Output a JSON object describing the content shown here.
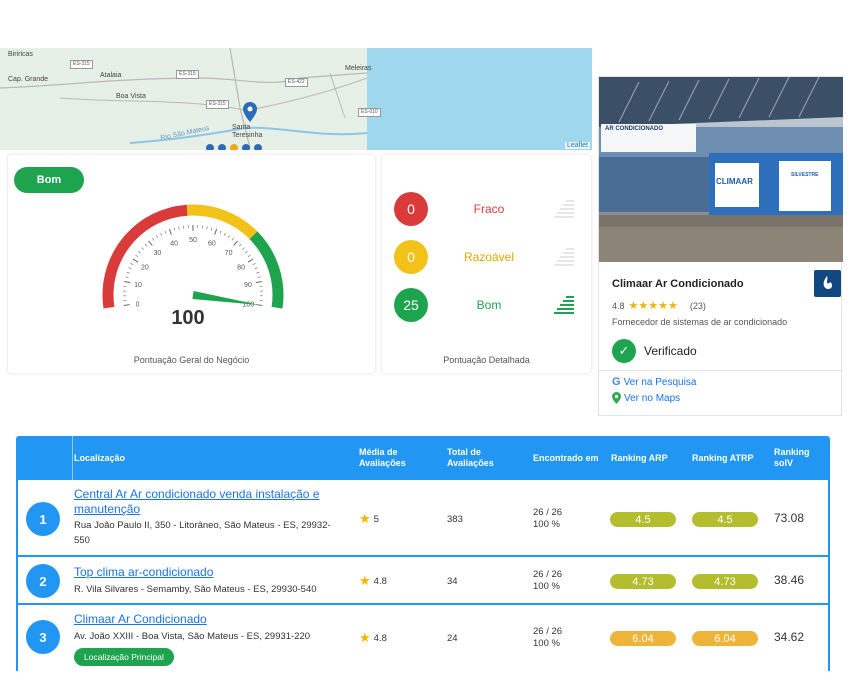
{
  "map": {
    "places": [
      "Biriricas",
      "Cap. Grande",
      "Atalaia",
      "Boa Vista",
      "Meleiras",
      "Santa Teresinha",
      "Rio São Mateus"
    ],
    "roads": [
      "ES-315",
      "ES-315",
      "ES-422",
      "ES-315",
      "ES-010"
    ],
    "attribution": "Leaflet"
  },
  "score": {
    "badge": "Bom",
    "value": "100",
    "ticks": [
      "0",
      "10",
      "20",
      "30",
      "40",
      "50",
      "60",
      "70",
      "80",
      "90",
      "100"
    ],
    "caption": "Pontuação Geral do Negócio",
    "colors": {
      "red": "#d93b3b",
      "yellow": "#f2c21b",
      "green": "#1ea44f"
    }
  },
  "detail": {
    "caption": "Pontuação Detalhada",
    "rows": [
      {
        "count": "0",
        "label": "Fraco",
        "color": "#d93b3b"
      },
      {
        "count": "0",
        "label": "Razoável",
        "color": "#f2c21b"
      },
      {
        "count": "25",
        "label": "Bom",
        "color": "#1ea44f"
      }
    ]
  },
  "business": {
    "name": "Climaar Ar Condicionado",
    "rating": "4.8",
    "reviews": "(23)",
    "category": "Fornecedor de sistemas de ar condicionado",
    "verified": "Verificado",
    "link_search": "Ver na Pesquisa",
    "link_maps": "Ver no Maps",
    "photo_signs": {
      "sign1": "AR CONDICIONADO",
      "sign2": "CLIMAAR",
      "sign3": "SILVESTRE"
    }
  },
  "table": {
    "headers": {
      "location": "Localização",
      "avg": "Média de Avaliações",
      "total": "Total de Avaliações",
      "found": "Encontrado em",
      "arp": "Ranking ARP",
      "atrp": "Ranking ATRP",
      "solv": "Ranking solV"
    },
    "rows": [
      {
        "n": "1",
        "name": "Central Ar Ar condicionado venda instalação e manutenção",
        "address": "Rua João Paulo II, 350 - Litorâneo, São Mateus - ES, 29932-550",
        "avg": "5",
        "total": "383",
        "found": "26 / 26",
        "pct": "100 %",
        "arp": "4.5",
        "atrp": "4.5",
        "solv": "73.08",
        "pill_color": "#b4bd2e"
      },
      {
        "n": "2",
        "name": "Top clima ar-condicionado",
        "address": "R. Vila Silvares - Semamby, São Mateus - ES, 29930-540",
        "avg": "4.8",
        "total": "34",
        "found": "26 / 26",
        "pct": "100 %",
        "arp": "4.73",
        "atrp": "4.73",
        "solv": "38.46",
        "pill_color": "#b4bd2e"
      },
      {
        "n": "3",
        "name": "Climaar Ar Condicionado",
        "address": "Av. João XXIII - Boa Vista, São Mateus - ES, 29931-220",
        "badge": "Localização Principal",
        "avg": "4.8",
        "total": "24",
        "found": "26 / 26",
        "pct": "100 %",
        "arp": "6.04",
        "atrp": "6.04",
        "solv": "34.62",
        "pill_color": "#eeb43a"
      }
    ]
  }
}
